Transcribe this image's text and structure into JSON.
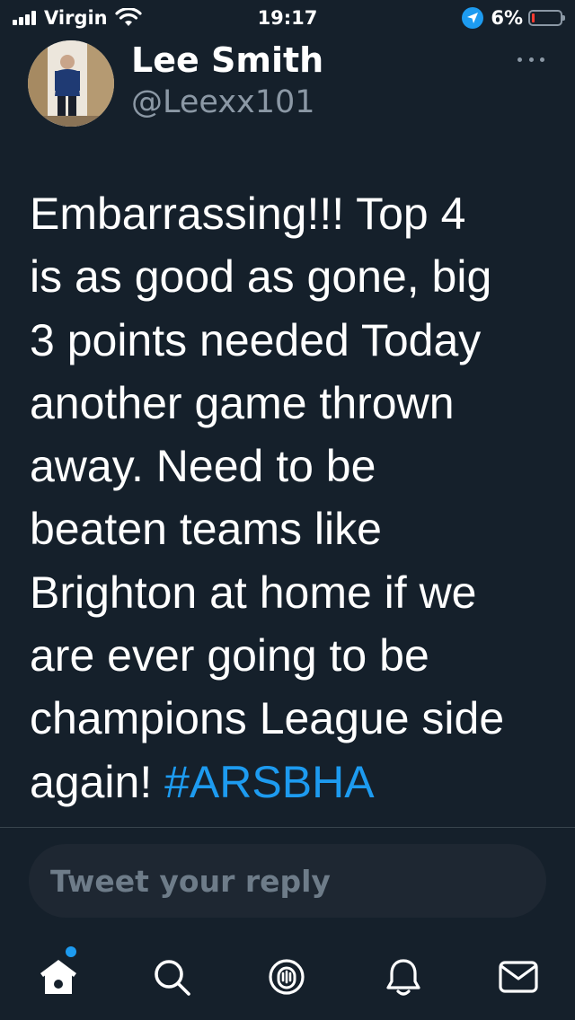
{
  "status_bar": {
    "carrier": "Virgin",
    "time": "19:17",
    "battery": "6%",
    "battery_level": 0.06,
    "icons": [
      "signal-icon",
      "wifi-icon",
      "location-icon",
      "battery-icon"
    ]
  },
  "tweet": {
    "author_name": "Lee Smith",
    "author_handle": "@Leexx101",
    "text_lines": [
      "Embarrassing!!! Top 4",
      "is as good as gone, big",
      "3 points needed Today",
      "another game thrown",
      "away. Need to be",
      "beaten teams like",
      "Brighton at home if we",
      "are ever going to be",
      "champions League side",
      "again! "
    ],
    "hashtag": "#ARSBHA"
  },
  "reply": {
    "placeholder": "Tweet your reply"
  },
  "tab_bar": {
    "items": [
      "home-icon",
      "search-icon",
      "spaces-icon",
      "notifications-icon",
      "messages-icon"
    ],
    "home_has_unread": true
  },
  "colors": {
    "background": "#15202b",
    "accent": "#1d9bf0",
    "secondary_text": "#8b98a5",
    "battery_low": "#ff3b30"
  }
}
